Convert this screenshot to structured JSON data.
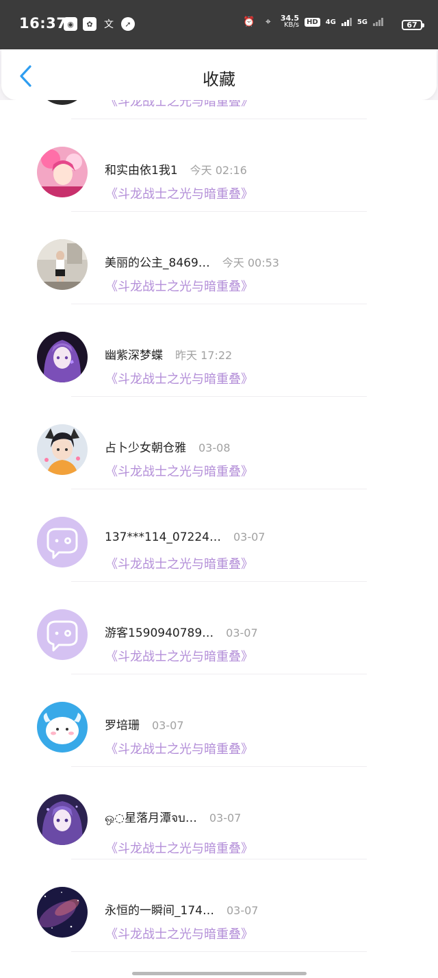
{
  "status_bar": {
    "time": "16:37",
    "speed_value": "34.5",
    "speed_unit": "KB/s",
    "hd_label": "HD",
    "sim1": "4G",
    "sim2": "5G",
    "battery": "67",
    "icons": [
      "app-icon",
      "baidu-icon",
      "translate-icon",
      "compass-icon",
      "alarm-icon",
      "location-icon"
    ]
  },
  "header": {
    "title": "收藏",
    "back_icon": "chevron-left-icon"
  },
  "accent_color": "#b38ed8",
  "items": [
    {
      "name": "",
      "time": "",
      "work": "《斗龙战士之光与暗重叠》",
      "avatar": "photo-girl"
    },
    {
      "name": "和实由依1我1",
      "time": "今天 02:16",
      "work": "《斗龙战士之光与暗重叠》",
      "avatar": "anime-pink"
    },
    {
      "name": "美丽的公主_8469…",
      "time": "今天 00:53",
      "work": "《斗龙战士之光与暗重叠》",
      "avatar": "photo-room"
    },
    {
      "name": "幽紫深梦蝶",
      "time": "昨天 17:22",
      "work": "《斗龙战士之光与暗重叠》",
      "avatar": "anime-purple"
    },
    {
      "name": "占卜少女朝仓雅",
      "time": "03-08",
      "work": "《斗龙战士之光与暗重叠》",
      "avatar": "anime-boy"
    },
    {
      "name": "137***114_07224…",
      "time": "03-07",
      "work": "《斗龙战士之光与暗重叠》",
      "avatar": "default-chat"
    },
    {
      "name": "游客1590940789…",
      "time": "03-07",
      "work": "《斗龙战士之光与暗重叠》",
      "avatar": "default-chat"
    },
    {
      "name": "罗培珊",
      "time": "03-07",
      "work": "《斗龙战士之光与暗重叠》",
      "avatar": "blue-blob"
    },
    {
      "name": "ஒ◌星落月潭จบ…",
      "time": "03-07",
      "work": "《斗龙战士之光与暗重叠》",
      "avatar": "anime-violet"
    },
    {
      "name": "永恒的一瞬间_174…",
      "time": "03-07",
      "work": "《斗龙战士之光与暗重叠》",
      "avatar": "galaxy"
    }
  ]
}
